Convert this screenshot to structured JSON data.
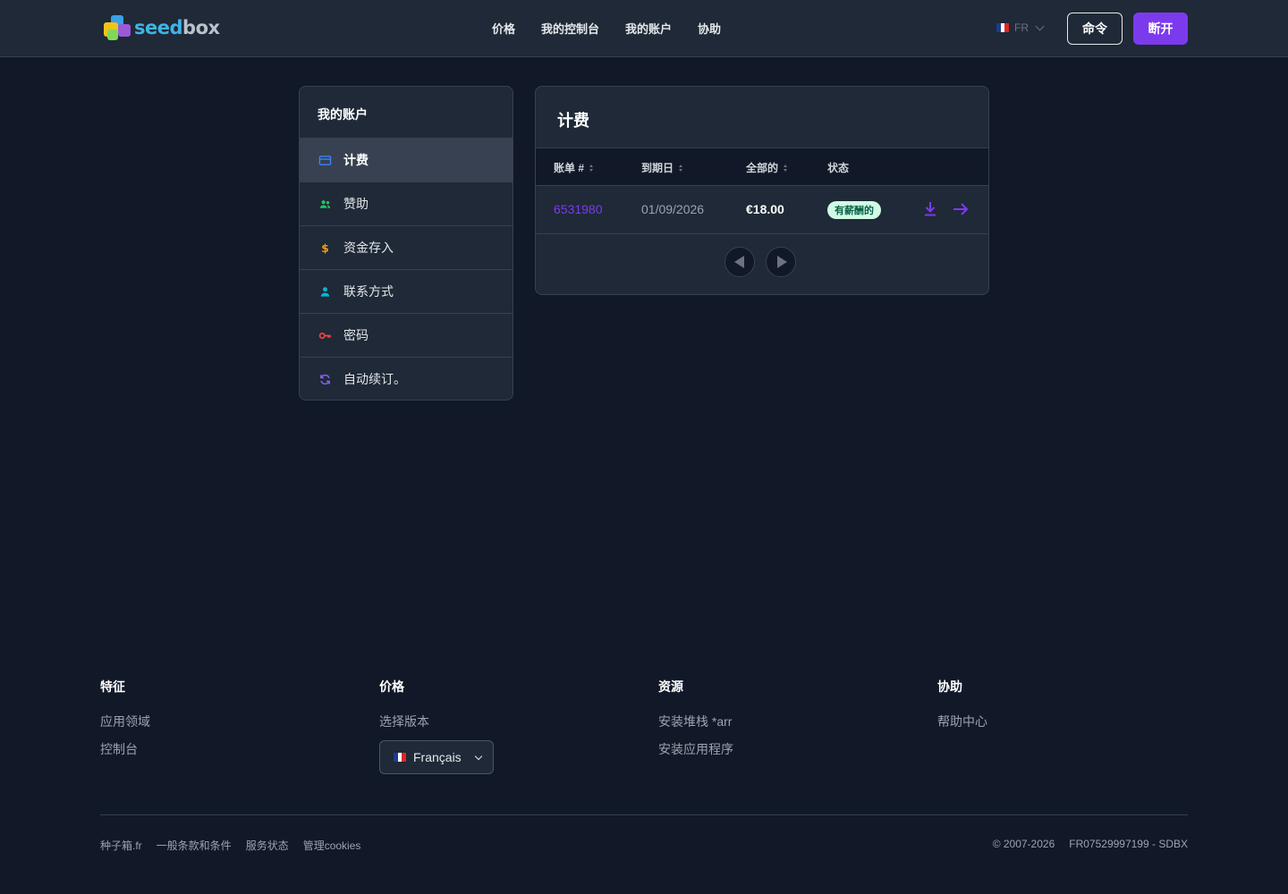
{
  "header": {
    "logo_part1": "seed",
    "logo_part2": "box",
    "nav": [
      "价格",
      "我的控制台",
      "我的账户",
      "协助"
    ],
    "lang_code": "FR",
    "command_button": "命令",
    "disconnect_button": "断开"
  },
  "sidebar": {
    "title": "我的账户",
    "items": [
      {
        "label": "计费",
        "icon": "credit-card-icon",
        "active": true
      },
      {
        "label": "赞助",
        "icon": "users-icon"
      },
      {
        "label": "资金存入",
        "icon": "dollar-icon"
      },
      {
        "label": "联系方式",
        "icon": "user-icon"
      },
      {
        "label": "密码",
        "icon": "key-icon"
      },
      {
        "label": "自动续订。",
        "icon": "refresh-icon"
      }
    ]
  },
  "billing": {
    "title": "计费",
    "columns": [
      "账单 #",
      "到期日",
      "全部的",
      "状态"
    ],
    "rows": [
      {
        "invoice": "6531980",
        "due": "01/09/2026",
        "total": "€18.00",
        "status": "有薪酬的"
      }
    ]
  },
  "footer": {
    "columns": [
      {
        "heading": "特征",
        "links": [
          "应用领域",
          "控制台"
        ]
      },
      {
        "heading": "价格",
        "links": [
          "选择版本"
        ]
      },
      {
        "heading": "资源",
        "links": [
          "安装堆栈 *arr",
          "安装应用程序"
        ]
      },
      {
        "heading": "协助",
        "links": [
          "帮助中心"
        ]
      }
    ],
    "language": "Français",
    "bottom_links": [
      "种子箱.fr",
      "一般条款和条件",
      "服务状态",
      "管理cookies"
    ],
    "copyright": "© 2007-2026",
    "vat": "FR07529997199 - SDBX"
  },
  "colors": {
    "accent": "#7c3aed",
    "background": "#111827",
    "panel": "#1f2937",
    "paid_badge": "#d1fae5"
  }
}
